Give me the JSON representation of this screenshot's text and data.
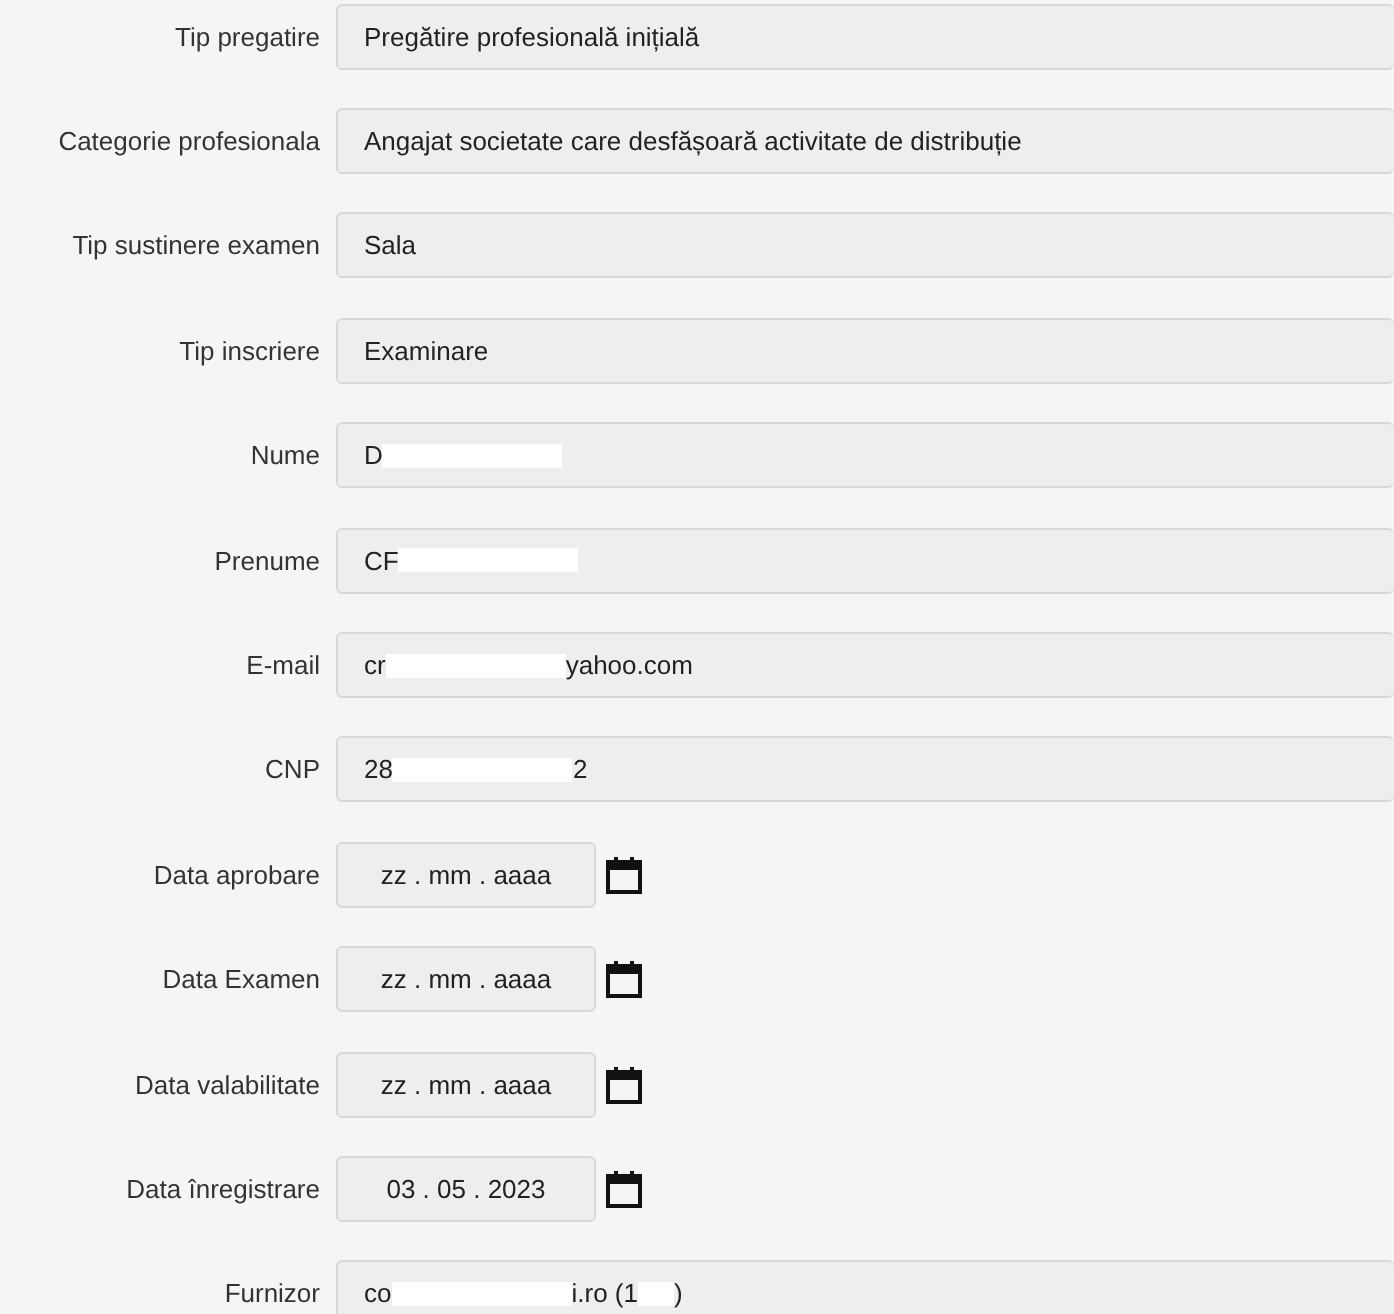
{
  "fields": [
    {
      "kind": "text",
      "label": "Tip pregatire",
      "value": "Pregătire profesională inițială"
    },
    {
      "kind": "text",
      "label": "Categorie profesionala",
      "value": "Angajat societate care desfășoară activitate de distribuție"
    },
    {
      "kind": "text",
      "label": "Tip sustinere examen",
      "value": "Sala"
    },
    {
      "kind": "text",
      "label": "Tip inscriere",
      "value": "Examinare"
    },
    {
      "kind": "redacted",
      "label": "Nume",
      "before": "D"
    },
    {
      "kind": "redacted",
      "label": "Prenume",
      "before": "CF"
    },
    {
      "kind": "redacted",
      "label": "E-mail",
      "before": "cr",
      "after": "yahoo.com"
    },
    {
      "kind": "redacted",
      "label": "CNP",
      "before": "28",
      "after": "2"
    },
    {
      "kind": "date",
      "label": "Data aprobare",
      "placeholder": "zz . mm . aaaa"
    },
    {
      "kind": "date",
      "label": "Data Examen",
      "placeholder": "zz . mm . aaaa"
    },
    {
      "kind": "date",
      "label": "Data valabilitate",
      "placeholder": "zz . mm . aaaa"
    },
    {
      "kind": "date",
      "label": "Data înregistrare",
      "value": "03 . 05 . 2023"
    },
    {
      "kind": "redacted",
      "label": "Furnizor",
      "before": "co",
      "after": "i.ro (1",
      "tail": ")"
    }
  ]
}
